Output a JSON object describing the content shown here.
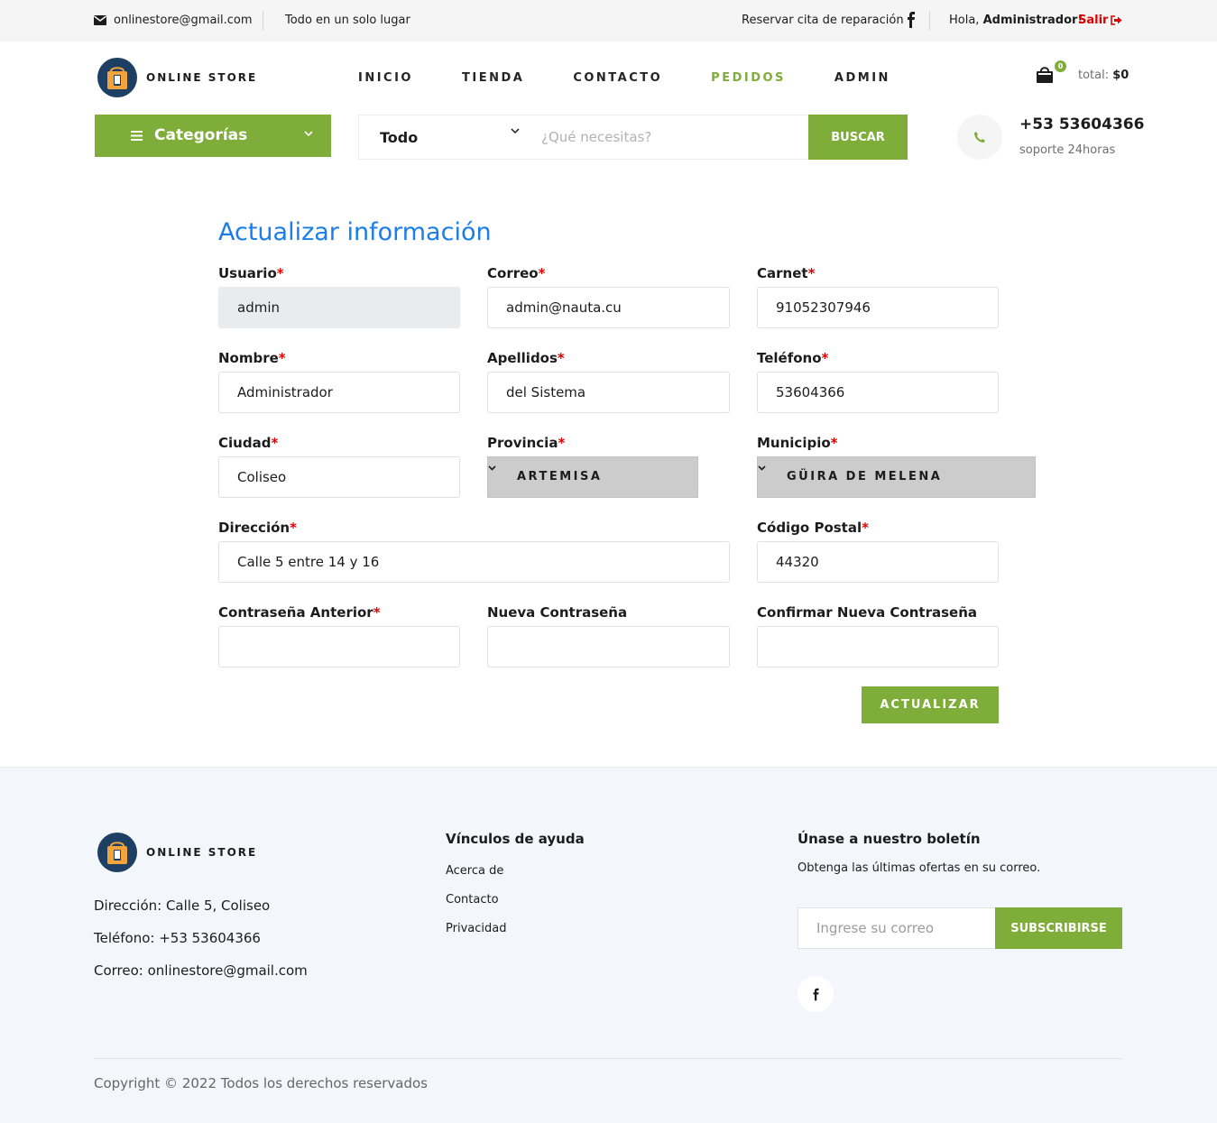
{
  "topbar": {
    "email": "onlinestore@gmail.com",
    "slogan": "Todo en un solo lugar",
    "repair": "Reservar cita de reparación",
    "hello_prefix": "Hola, ",
    "hello_user": "Administrador!",
    "logout": "Salir"
  },
  "brand": {
    "name": "ONLINE STORE"
  },
  "nav": [
    {
      "label": "INICIO",
      "active": false
    },
    {
      "label": "TIENDA",
      "active": false
    },
    {
      "label": "CONTACTO",
      "active": false
    },
    {
      "label": "PEDIDOS",
      "active": true
    },
    {
      "label": "ADMIN",
      "active": false
    }
  ],
  "cart": {
    "count": "0",
    "total_label": "total:",
    "total_value": "$0"
  },
  "categories": {
    "label": "Categorías"
  },
  "search": {
    "category": "Todo",
    "placeholder": "¿Qué necesitas?",
    "button": "BUSCAR"
  },
  "support": {
    "phone": "+53 53604366",
    "label": "soporte 24horas"
  },
  "form": {
    "title": "Actualizar información",
    "fields": {
      "usuario": {
        "label": "Usuario",
        "value": "admin"
      },
      "correo": {
        "label": "Correo",
        "value": "admin@nauta.cu"
      },
      "carnet": {
        "label": "Carnet",
        "value": "91052307946"
      },
      "nombre": {
        "label": "Nombre",
        "value": "Administrador"
      },
      "apellidos": {
        "label": "Apellidos",
        "value": "del Sistema"
      },
      "telefono": {
        "label": "Teléfono",
        "value": "53604366"
      },
      "ciudad": {
        "label": "Ciudad",
        "value": "Coliseo"
      },
      "provincia": {
        "label": "Provincia",
        "value": "ARTEMISA"
      },
      "municipio": {
        "label": "Municipio",
        "value": "GÜIRA DE MELENA"
      },
      "direccion": {
        "label": "Dirección",
        "value": "Calle 5 entre 14 y 16"
      },
      "codigo_postal": {
        "label": "Código Postal",
        "value": "44320"
      },
      "pass_old": {
        "label": "Contraseña Anterior",
        "value": ""
      },
      "pass_new": {
        "label": "Nueva Contraseña",
        "value": ""
      },
      "pass_confirm": {
        "label": "Confirmar Nueva Contraseña",
        "value": ""
      }
    },
    "required_mark": "*",
    "submit": "ACTUALIZAR"
  },
  "footer": {
    "address": "Dirección: Calle 5, Coliseo",
    "phone": "Teléfono: +53 53604366",
    "email": "Correo: onlinestore@gmail.com",
    "links_title": "Vínculos de ayuda",
    "links": [
      "Acerca de",
      "Contacto",
      "Privacidad"
    ],
    "newsletter_title": "Únase a nuestro boletín",
    "newsletter_text": "Obtenga las últimas ofertas en su correo.",
    "newsletter_placeholder": "Ingrese su correo",
    "newsletter_button": "SUBSCRIBIRSE",
    "copyright": "Copyright © 2022 Todos los derechos reservados"
  },
  "colors": {
    "accent": "#7fad39",
    "title_blue": "#1a7ee6",
    "danger": "#e20000"
  }
}
